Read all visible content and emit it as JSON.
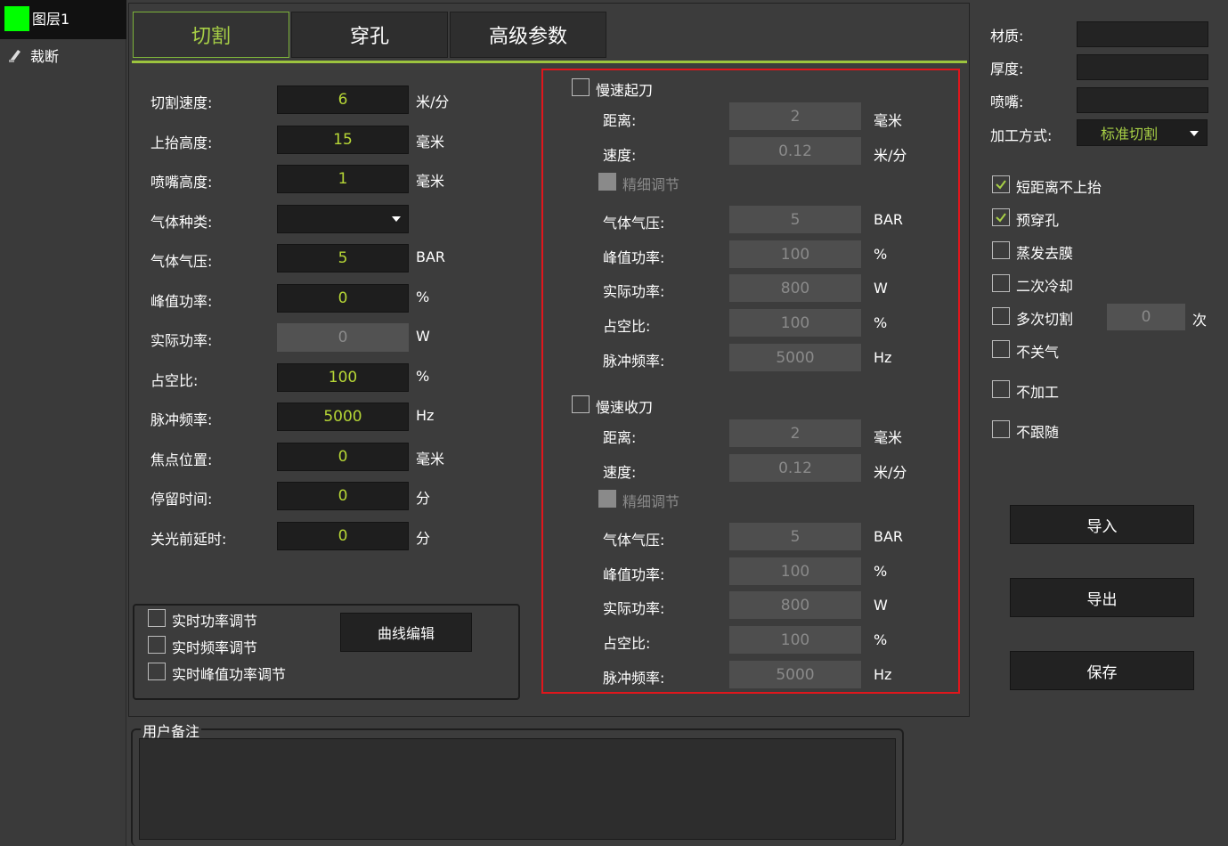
{
  "layers": {
    "layer_name": "图层1",
    "cut_label": "裁断"
  },
  "tabs": [
    "切割",
    "穿孔",
    "高级参数"
  ],
  "params": [
    {
      "label": "切割速度:",
      "value": "6",
      "unit": "米/分"
    },
    {
      "label": "上抬高度:",
      "value": "15",
      "unit": "毫米"
    },
    {
      "label": "喷嘴高度:",
      "value": "1",
      "unit": "毫米"
    },
    {
      "label": "气体种类:",
      "value": "",
      "unit": ""
    },
    {
      "label": "气体气压:",
      "value": "5",
      "unit": "BAR"
    },
    {
      "label": "峰值功率:",
      "value": "0",
      "unit": "%"
    },
    {
      "label": "实际功率:",
      "value": "0",
      "unit": "W"
    },
    {
      "label": "占空比:",
      "value": "100",
      "unit": "%"
    },
    {
      "label": "脉冲频率:",
      "value": "5000",
      "unit": "Hz"
    },
    {
      "label": "焦点位置:",
      "value": "0",
      "unit": "毫米"
    },
    {
      "label": "停留时间:",
      "value": "0",
      "unit": "分"
    },
    {
      "label": "关光前延时:",
      "value": "0",
      "unit": "分"
    }
  ],
  "realtime": {
    "items": [
      "实时功率调节",
      "实时频率调节",
      "实时峰值功率调节"
    ],
    "curve_button": "曲线编辑"
  },
  "slow_start": {
    "title": "慢速起刀",
    "distance": {
      "label": "距离:",
      "value": "2",
      "unit": "毫米"
    },
    "speed": {
      "label": "速度:",
      "value": "0.12",
      "unit": "米/分"
    },
    "fine": "精细调节",
    "rows": [
      {
        "label": "气体气压:",
        "value": "5",
        "unit": "BAR"
      },
      {
        "label": "峰值功率:",
        "value": "100",
        "unit": "%"
      },
      {
        "label": "实际功率:",
        "value": "800",
        "unit": "W"
      },
      {
        "label": "占空比:",
        "value": "100",
        "unit": "%"
      },
      {
        "label": "脉冲频率:",
        "value": "5000",
        "unit": "Hz"
      }
    ]
  },
  "slow_end": {
    "title": "慢速收刀",
    "distance": {
      "label": "距离:",
      "value": "2",
      "unit": "毫米"
    },
    "speed": {
      "label": "速度:",
      "value": "0.12",
      "unit": "米/分"
    },
    "fine": "精细调节",
    "rows": [
      {
        "label": "气体气压:",
        "value": "5",
        "unit": "BAR"
      },
      {
        "label": "峰值功率:",
        "value": "100",
        "unit": "%"
      },
      {
        "label": "实际功率:",
        "value": "800",
        "unit": "W"
      },
      {
        "label": "占空比:",
        "value": "100",
        "unit": "%"
      },
      {
        "label": "脉冲频率:",
        "value": "5000",
        "unit": "Hz"
      }
    ]
  },
  "notes": {
    "title": "用户备注"
  },
  "right": {
    "material_label": "材质:",
    "thickness_label": "厚度:",
    "nozzle_label": "喷嘴:",
    "method_label": "加工方式:",
    "method_value": "标准切割",
    "options": [
      {
        "label": "短距离不上抬",
        "checked": true
      },
      {
        "label": "预穿孔",
        "checked": true
      },
      {
        "label": "蒸发去膜",
        "checked": false
      },
      {
        "label": "二次冷却",
        "checked": false
      },
      {
        "label": "多次切割",
        "checked": false
      },
      {
        "label": "不关气",
        "checked": false
      },
      {
        "label": "不加工",
        "checked": false
      },
      {
        "label": "不跟随",
        "checked": false
      }
    ],
    "multi_count": "0",
    "multi_unit": "次",
    "import_label": "导入",
    "export_label": "导出",
    "save_label": "保存"
  },
  "colors": {
    "accent_green": "#a8d046",
    "layer_green": "#00ff00",
    "highlight_red": "#e0161c"
  }
}
